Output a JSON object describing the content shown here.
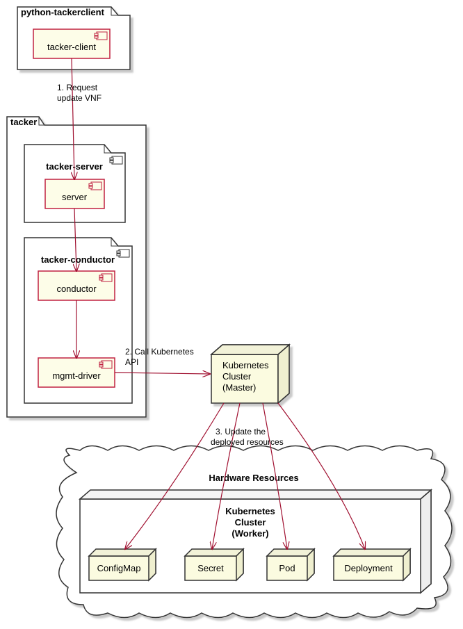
{
  "packages": {
    "pkg1": {
      "title": "python-tackerclient"
    },
    "pkg2": {
      "title": "tacker"
    },
    "pkg3": {
      "title": "tacker-server"
    },
    "pkg4": {
      "title": "tacker-conductor"
    }
  },
  "components": {
    "comp1": {
      "label": "tacker-client"
    },
    "comp2": {
      "label": "server"
    },
    "comp3": {
      "label": "conductor"
    },
    "comp4": {
      "label": "mgmt-driver"
    }
  },
  "nodes": {
    "master": {
      "line1": "Kubernetes",
      "line2": "Cluster",
      "line3": "(Master)"
    },
    "worker": {
      "line1": "Kubernetes",
      "line2": "Cluster",
      "line3": "(Worker)"
    },
    "configmap": {
      "label": "ConfigMap"
    },
    "secret": {
      "label": "Secret"
    },
    "pod": {
      "label": "Pod"
    },
    "deployment": {
      "label": "Deployment"
    }
  },
  "cloud": {
    "title": "Hardware Resources"
  },
  "arrows": {
    "a1": {
      "line1": "1. Request",
      "line2": "update VNF"
    },
    "a2": {
      "line1": "2. Call Kubernetes",
      "line2": "API"
    },
    "a3": {
      "line1": "3. Update the",
      "line2": "deployed resources"
    }
  },
  "colors": {
    "component_fill": "#fdfde8",
    "component_stroke": "#c02040",
    "node_fill": "#fbfbe0",
    "node_stroke": "#333333",
    "package_stroke": "#333333",
    "arrow": "#a01030",
    "shadow": "#cccccc"
  }
}
